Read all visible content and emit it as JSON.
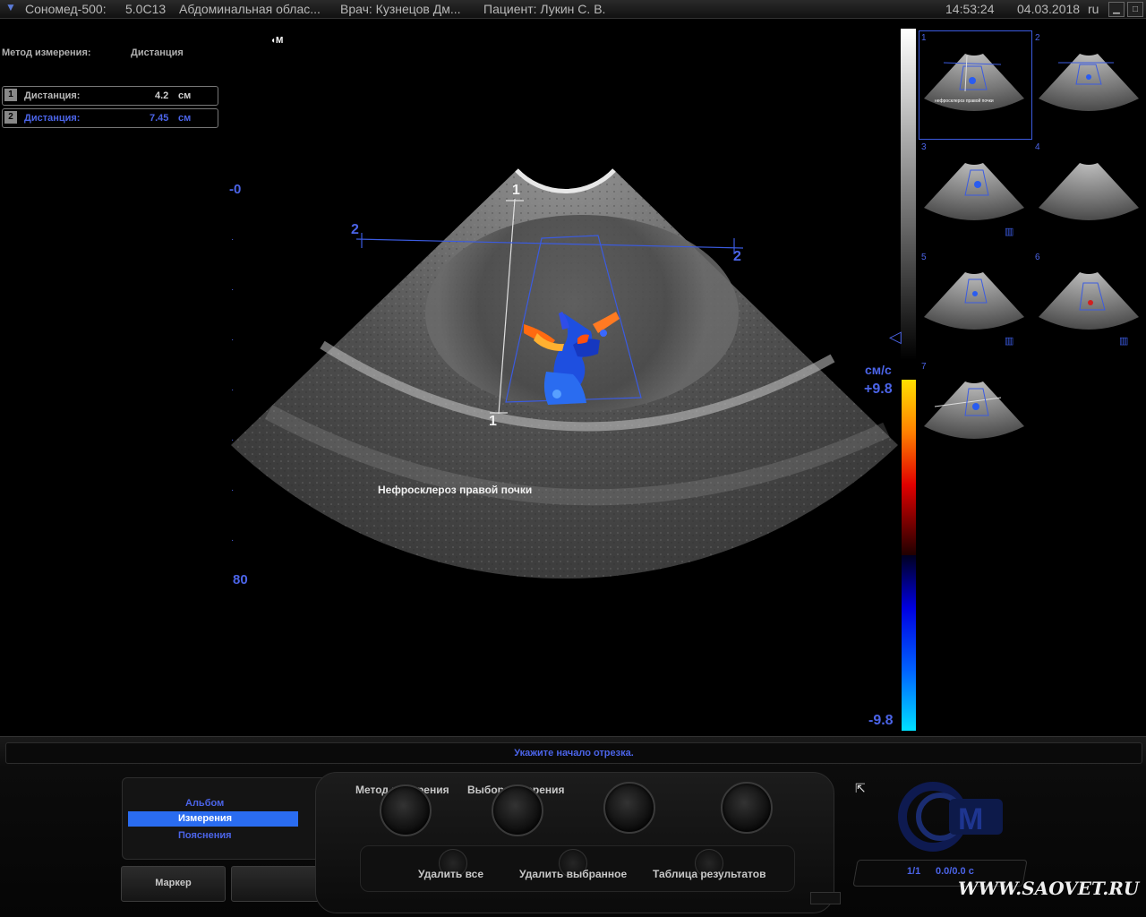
{
  "titlebar": {
    "device": "Сономед-500:",
    "probe": "5.0C13",
    "preset": "Абдоминальная облас...",
    "doctor": "Врач: Кузнецов Дм...",
    "patient": "Пациент: Лукин С. В.",
    "time": "14:53:24",
    "date": "04.03.2018",
    "lang": "ru"
  },
  "measurement": {
    "method_label": "Метод измерения:",
    "method_value": "Дистанция",
    "items": [
      {
        "num": "1",
        "label": "Дистанция:",
        "value": "4.2",
        "unit": "см"
      },
      {
        "num": "2",
        "label": "Дистанция:",
        "value": "7.45",
        "unit": "см"
      }
    ]
  },
  "depth": {
    "top": "-0",
    "bottom": "80"
  },
  "calipers": {
    "line1_start": "1",
    "line1_end": "1",
    "line2_start": "2",
    "line2_end": "2"
  },
  "annotation": "Нефросклероз правой почки",
  "color_scale": {
    "unit": "см/с",
    "max": "+9.8",
    "min": "-9.8"
  },
  "thumbnails": [
    "1",
    "2",
    "3",
    "4",
    "5",
    "6",
    "7"
  ],
  "thumb_caption": "нефросклероз правой почки",
  "status_message": "Укажите начало отрезка.",
  "menu": {
    "items": [
      "Альбом",
      "Измерения",
      "Пояснения"
    ],
    "selected": "Измерения"
  },
  "buttons": {
    "marker": "Маркер",
    "method": "Метод измерения",
    "choice": "Выбор измерения",
    "delete_all": "Удалить все",
    "delete_selected": "Удалить выбранное",
    "results_table": "Таблица результатов"
  },
  "cine": {
    "frame": "1/1",
    "time": "0.0/0.0 с"
  },
  "watermark": "WWW.SAOVET.RU",
  "colors": {
    "accent": "#4b64e8",
    "selected": "#2a6cf0"
  }
}
